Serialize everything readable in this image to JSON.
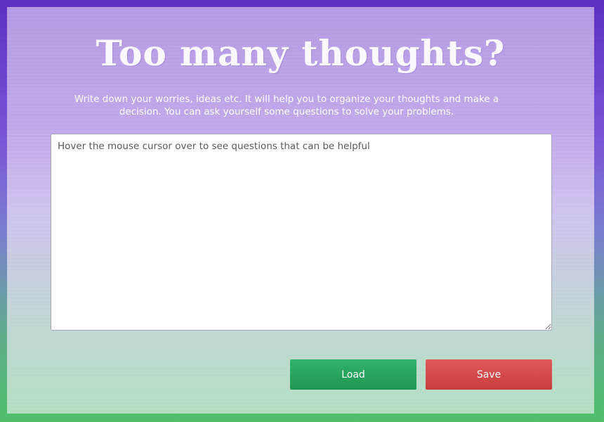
{
  "header": {
    "title": "Too many thoughts?",
    "subtitle": "Write down your worries, ideas etc. It will help you to organize your thoughts and make a decision. You can ask yourself some questions to solve your problems."
  },
  "editor": {
    "value": "",
    "placeholder": "Hover the mouse cursor over to see questions that can be helpful"
  },
  "actions": {
    "load_label": "Load",
    "save_label": "Save"
  },
  "colors": {
    "load_button": "#27a55e",
    "save_button": "#d64c4c",
    "title_text": "#fbf8ff"
  }
}
